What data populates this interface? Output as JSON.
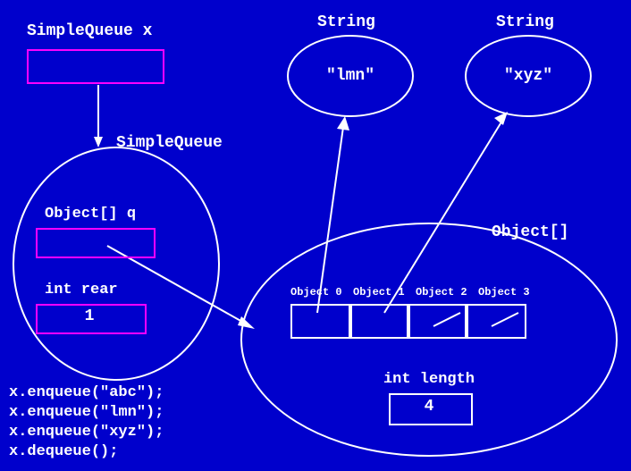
{
  "title_var": "SimpleQueue x",
  "string_label_1": "String",
  "string_label_2": "String",
  "string_val_1": "\"lmn\"",
  "string_val_2": "\"xyz\"",
  "class_label": "SimpleQueue",
  "field_q": "Object[] q",
  "field_rear": "int rear",
  "rear_value": "1",
  "objarray_label": "Object[]",
  "slot_labels": {
    "s0": "Object 0",
    "s1": "Object 1",
    "s2": "Object 2",
    "s3": "Object 3"
  },
  "length_label": "int length",
  "length_value": "4",
  "code_lines": {
    "l1": "x.enqueue(\"abc\");",
    "l2": "x.enqueue(\"lmn\");",
    "l3": "x.enqueue(\"xyz\");",
    "l4": "x.dequeue();"
  }
}
